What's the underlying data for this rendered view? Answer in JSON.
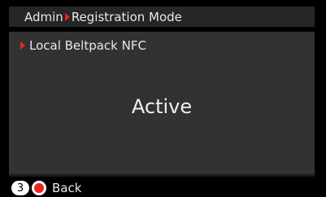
{
  "breadcrumb": {
    "root": "Admin",
    "current": "Registration Mode",
    "separator_icon": "triangle-right-icon"
  },
  "panel": {
    "item_label": "Local Beltpack NFC",
    "status_value": "Active"
  },
  "footer": {
    "key_number": "3",
    "back_label": "Back"
  },
  "colors": {
    "background": "#000000",
    "title_bar": "#262626",
    "panel": "#323232",
    "accent_red": "#e8251c",
    "text": "#e8e8e8"
  }
}
